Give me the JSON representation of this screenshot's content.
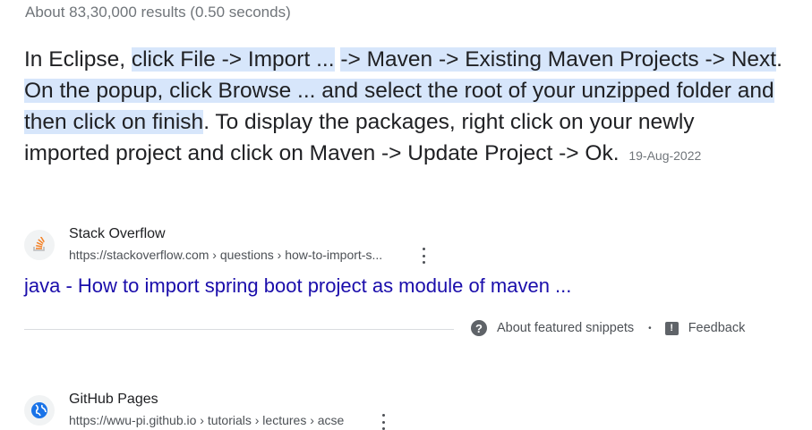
{
  "search_stats": "About 83,30,000 results (0.50 seconds)",
  "snippet": {
    "before": "In Eclipse, ",
    "highlight_1": "click File -> Import ...",
    "gap": " ",
    "highlight_2": "-> Maven -> Existing Maven Projects -> Next",
    "mid": ". ",
    "highlight_3": "On the popup, click Browse ... and select the root of your unzipped folder and then click on finish",
    "after": ". To display the packages, right click on your newly imported project and click on Maven -> Update Project -> Ok.",
    "date": "19-Aug-2022"
  },
  "results": [
    {
      "site_name": "Stack Overflow",
      "url": "https://stackoverflow.com › questions › how-to-import-s...",
      "title": "java - How to import spring boot project as module of maven ...",
      "icon": "stackoverflow-icon"
    },
    {
      "site_name": "GitHub Pages",
      "url": "https://wwu-pi.github.io › tutorials › lectures › acse",
      "icon": "globe-icon"
    }
  ],
  "footer": {
    "about_label": "About featured snippets",
    "separator": "•",
    "feedback_label": "Feedback"
  },
  "colors": {
    "highlight": "#d7e6fb",
    "link": "#1a0dab",
    "stackoverflow_orange": "#f48024",
    "globe_blue": "#1a73e8"
  }
}
